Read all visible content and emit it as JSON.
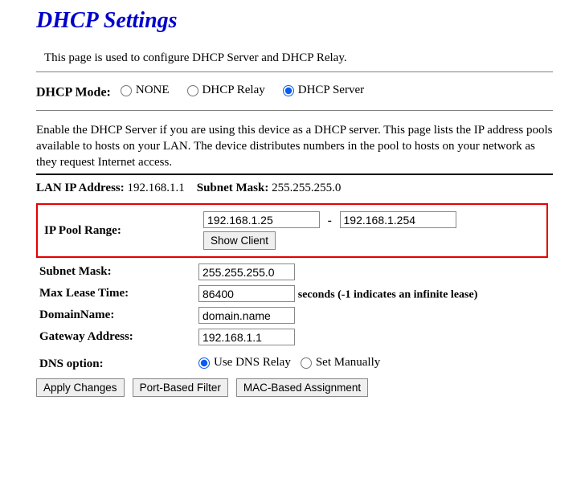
{
  "page_title": "DHCP Settings",
  "description": "This page is used to configure DHCP Server and DHCP Relay.",
  "mode": {
    "label": "DHCP Mode:",
    "options": {
      "none": "NONE",
      "relay": "DHCP Relay",
      "server": "DHCP Server"
    },
    "selected": "server"
  },
  "note": "Enable the DHCP Server if you are using this device as a DHCP server. This page lists the IP address pools available to hosts on your LAN. The device distributes numbers in the pool to hosts on your network as they request Internet access.",
  "lan": {
    "ip_label": "LAN IP Address:",
    "ip_value": "192.168.1.1",
    "mask_label": "Subnet Mask:",
    "mask_value": "255.255.255.0"
  },
  "pool": {
    "label": "IP Pool Range:",
    "from": "192.168.1.25",
    "to": "192.168.1.254",
    "show_client": "Show Client"
  },
  "subnet_mask": {
    "label": "Subnet Mask:",
    "value": "255.255.255.0"
  },
  "lease": {
    "label": "Max Lease Time:",
    "value": "86400",
    "hint": "seconds (-1 indicates an infinite lease)"
  },
  "domain": {
    "label": "DomainName:",
    "value": "domain.name"
  },
  "gateway": {
    "label": "Gateway Address:",
    "value": "192.168.1.1"
  },
  "dns": {
    "label": "DNS option:",
    "use_relay": "Use DNS Relay",
    "set_manual": "Set Manually",
    "selected": "use_relay"
  },
  "buttons": {
    "apply": "Apply Changes",
    "port_filter": "Port-Based Filter",
    "mac_assign": "MAC-Based Assignment"
  }
}
